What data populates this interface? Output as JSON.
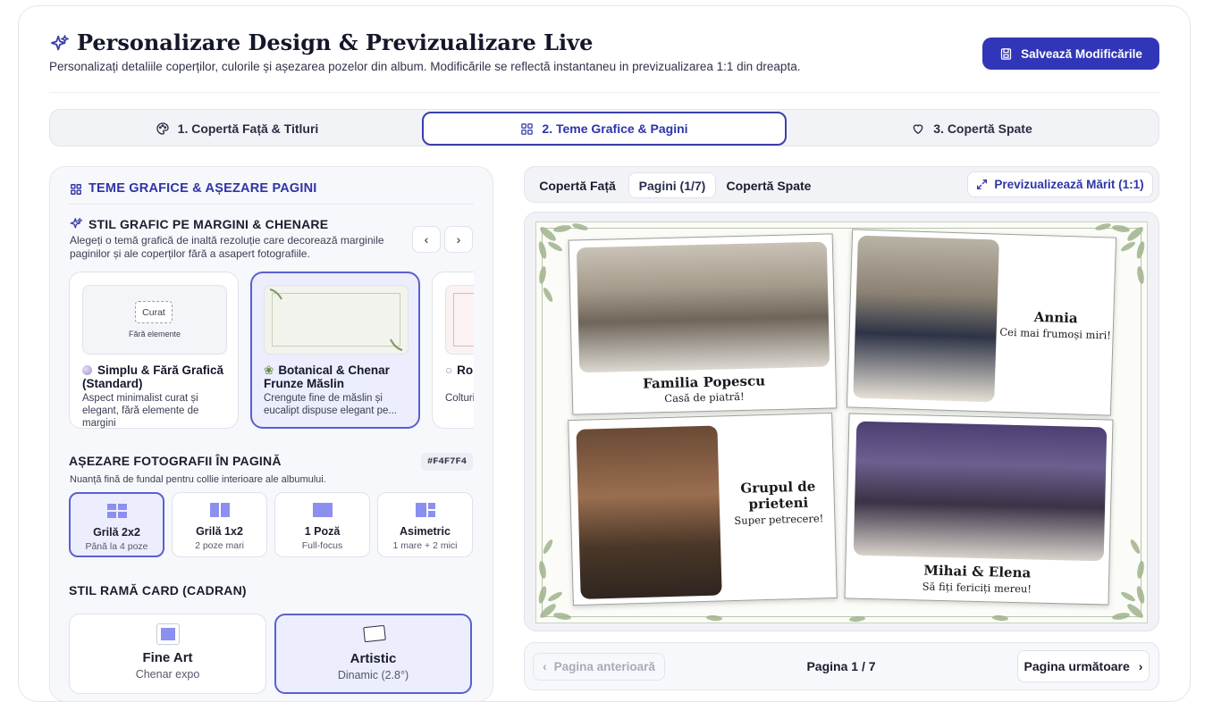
{
  "header": {
    "title": "Personalizare Design & Previzualizare Live",
    "subtitle": "Personalizați detaliile coperților, culorile și așezarea pozelor din album. Modificările se reflectă instantaneu in previzualizarea 1:1 din dreapta.",
    "save_label": "Salvează Modificările"
  },
  "main_tabs": [
    {
      "label": "1. Copertă Față & Titluri",
      "icon": "palette-icon"
    },
    {
      "label": "2. Teme Grafice & Pagini",
      "icon": "grid-icon",
      "active": true
    },
    {
      "label": "3. Copertă Spate",
      "icon": "heart-icon"
    }
  ],
  "left_panel": {
    "heading": "TEME GRAFICE & AȘEZARE PAGINI",
    "style_section": {
      "title": "STIL GRAFIC PE MARGINI & CHENARE",
      "description_line1": "Alegeți o temă grafică de inaltă rezoluție care decorează marginile",
      "description_line2": "paginilor și ale coperților fără a asapert fotografiile."
    },
    "themes": [
      {
        "thumb_label": "Curat",
        "thumb_sub": "Fără elemente",
        "name": "Simplu & Fără Grafică (Standard)",
        "desc": "Aspect minimalist curat și elegant, fără elemente de margini",
        "icon": "circle-icon"
      },
      {
        "name": "Botanical & Chenar Frunze Măslin",
        "desc": "Crengute fine de măslin și eucalipt dispuse elegant pe...",
        "icon": "leaf-icon",
        "selected": true
      },
      {
        "name": "Ro Bordu",
        "desc": "Colturi bordur",
        "icon": "ring-icon"
      }
    ],
    "layout_section": {
      "title": "AȘEZARE FOTOGRAFII ÎN PAGINĂ",
      "hex": "#F4F7F4",
      "description": "Nuanță fină de fundal pentru collie interioare ale albumului.",
      "options": [
        {
          "title": "Grilă 2x2",
          "sub": "Până la 4 poze",
          "selected": true
        },
        {
          "title": "Grilă 1x2",
          "sub": "2 poze mari"
        },
        {
          "title": "1 Poză",
          "sub": "Full-focus"
        },
        {
          "title": "Asimetric",
          "sub": "1 mare + 2 mici"
        }
      ]
    },
    "frame_section": {
      "title": "STIL RAMĂ CARD (CADRAN)",
      "options": [
        {
          "title": "Fine Art",
          "sub": "Chenar expo"
        },
        {
          "title": "Artistic",
          "sub": "Dinamic (2.8°)",
          "selected": true
        }
      ]
    }
  },
  "preview": {
    "tabs": [
      {
        "label": "Copertă Față"
      },
      {
        "label": "Pagini (1/7)",
        "active": true
      },
      {
        "label": "Copertă Spate"
      }
    ],
    "enlarge_label": "Previzualizează Mărit (1:1)",
    "cards": [
      {
        "title": "Familia Popescu",
        "sub": "Casă de piatră!"
      },
      {
        "title": "Annia",
        "sub": "Cei mai frumoși miri!"
      },
      {
        "title": "Grupul de prieteni",
        "sub": "Super petrecere!"
      },
      {
        "title": "Mihai & Elena",
        "sub": "Să fiți fericiți mereu!"
      }
    ]
  },
  "pager": {
    "prev_label": "Pagina anterioară",
    "page_label": "Pagina 1 / 7",
    "next_label": "Pagina următoare"
  },
  "colors": {
    "accent": "#3136b8",
    "selected_bg": "#eceefd",
    "selected_border": "#5a5fd0",
    "album_bg": "#fbfbf8",
    "leaf_green": "#8fa57d"
  }
}
